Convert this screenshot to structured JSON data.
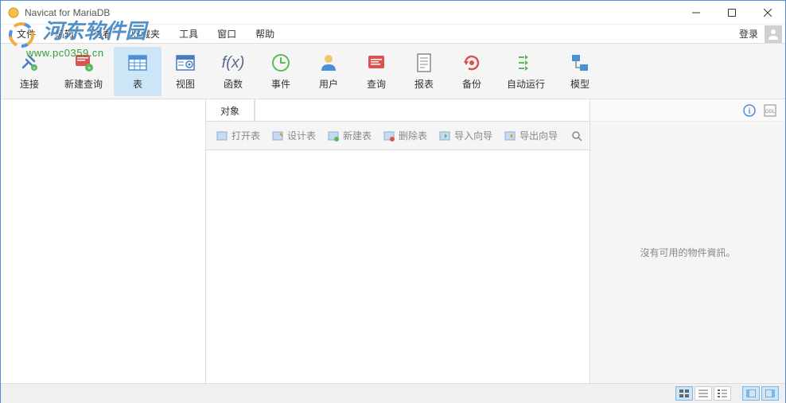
{
  "window": {
    "title": "Navicat for MariaDB",
    "login_label": "登录"
  },
  "menu": {
    "items": [
      "文件",
      "编辑",
      "查看",
      "收藏夹",
      "工具",
      "窗口",
      "帮助"
    ]
  },
  "toolbar": {
    "items": [
      {
        "label": "连接",
        "icon": "plug"
      },
      {
        "label": "新建查询",
        "icon": "newquery"
      },
      {
        "label": "表",
        "icon": "table",
        "active": true
      },
      {
        "label": "视图",
        "icon": "view"
      },
      {
        "label": "函数",
        "icon": "fx"
      },
      {
        "label": "事件",
        "icon": "clock"
      },
      {
        "label": "用户",
        "icon": "user"
      },
      {
        "label": "查询",
        "icon": "query"
      },
      {
        "label": "报表",
        "icon": "report"
      },
      {
        "label": "备份",
        "icon": "backup"
      },
      {
        "label": "自动运行",
        "icon": "auto"
      },
      {
        "label": "模型",
        "icon": "model"
      }
    ]
  },
  "tabs": {
    "items": [
      "对象"
    ]
  },
  "actions": {
    "items": [
      "打开表",
      "设计表",
      "新建表",
      "删除表",
      "导入向导",
      "导出向导"
    ]
  },
  "rightpanel": {
    "empty_message": "沒有可用的物件資訊。"
  },
  "watermark": {
    "text1": "河东软件园",
    "text2": "www.pc0359.cn"
  }
}
